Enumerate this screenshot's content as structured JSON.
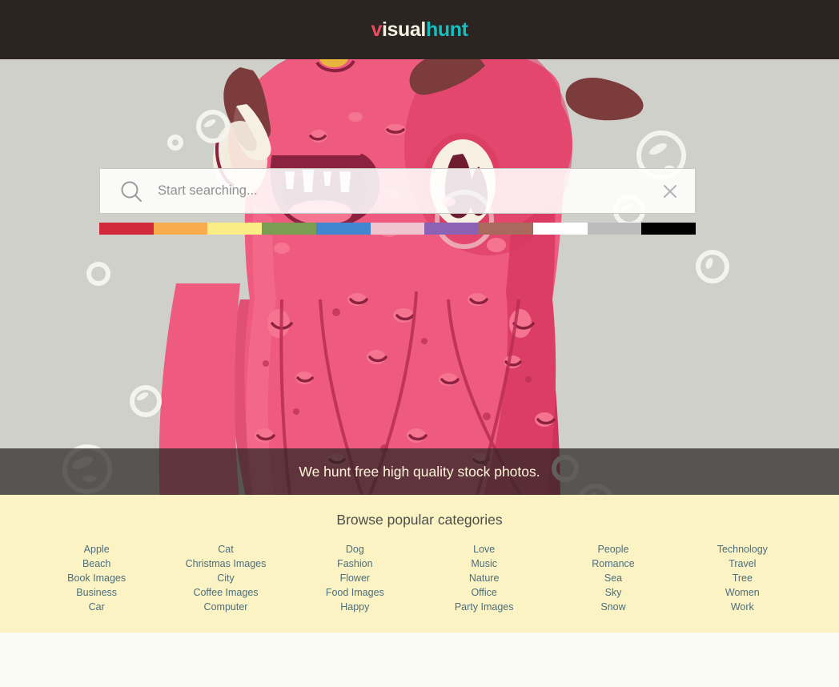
{
  "header": {
    "logo": {
      "part1": "v",
      "part2": "isual",
      "part3": "hunt"
    }
  },
  "hero": {
    "search": {
      "placeholder": "Start searching...",
      "value": "",
      "search_icon": "search-icon",
      "clear_icon": "close-icon"
    },
    "color_swatches": [
      {
        "name": "red",
        "hex": "#d1293a"
      },
      {
        "name": "orange",
        "hex": "#f9ac4e"
      },
      {
        "name": "yellow",
        "hex": "#fbed86"
      },
      {
        "name": "green",
        "hex": "#7a9c53"
      },
      {
        "name": "blue",
        "hex": "#4285d0"
      },
      {
        "name": "pink",
        "hex": "#f0c3d1"
      },
      {
        "name": "purple",
        "hex": "#8b62b4"
      },
      {
        "name": "brown",
        "hex": "#a9695c"
      },
      {
        "name": "white",
        "hex": "#ffffff"
      },
      {
        "name": "gray",
        "hex": "#bcbcbc"
      },
      {
        "name": "black",
        "hex": "#000000"
      }
    ],
    "tagline": "We hunt free high quality stock photos.",
    "background_colors": {
      "backdrop": "#d0d0cb",
      "monster_body": "#ef5a7f",
      "monster_shade": "#d8385f",
      "monster_dark": "#8c2140",
      "monster_horn": "#7d3c3c",
      "eye_white": "#f6efe2"
    }
  },
  "categories": {
    "title": "Browse popular categories",
    "columns": [
      {
        "items": [
          "Apple",
          "Beach",
          "Book Images",
          "Business",
          "Car"
        ]
      },
      {
        "items": [
          "Cat",
          "Christmas Images",
          "City",
          "Coffee Images",
          "Computer"
        ]
      },
      {
        "items": [
          "Dog",
          "Fashion",
          "Flower",
          "Food Images",
          "Happy"
        ]
      },
      {
        "items": [
          "Love",
          "Music",
          "Nature",
          "Office",
          "Party Images"
        ]
      },
      {
        "items": [
          "People",
          "Romance",
          "Sea",
          "Sky",
          "Snow"
        ]
      },
      {
        "items": [
          "Technology",
          "Travel",
          "Tree",
          "Women",
          "Work"
        ]
      }
    ]
  }
}
